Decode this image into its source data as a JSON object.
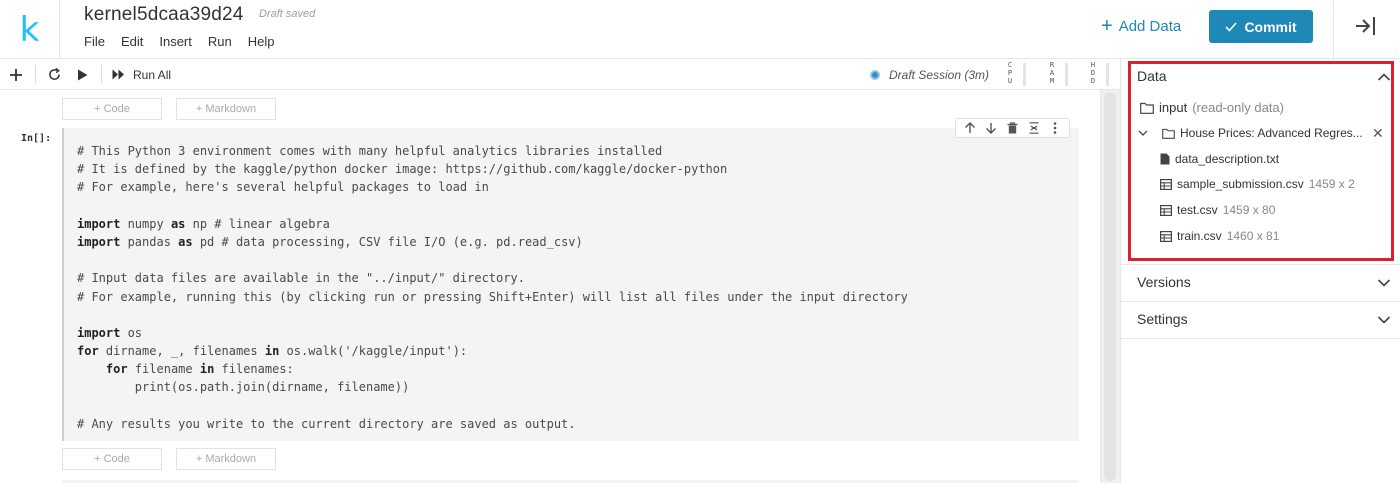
{
  "header": {
    "logo_letter": "k",
    "title": "kernel5dcaa39d24",
    "status": "Draft saved",
    "menu": [
      "File",
      "Edit",
      "Insert",
      "Run",
      "Help"
    ],
    "add_data_label": "Add Data",
    "commit_label": "Commit"
  },
  "toolbar": {
    "run_all_label": "Run All",
    "session_label": "Draft Session (3m)",
    "meters": [
      "CPU",
      "RAM",
      "HDD"
    ]
  },
  "notebook": {
    "add_code_label": "+ Code",
    "add_markdown_label": "+ Markdown",
    "prompt": "In[]:",
    "code_lines": [
      "# This Python 3 environment comes with many helpful analytics libraries installed",
      "# It is defined by the kaggle/python docker image: https://github.com/kaggle/docker-python",
      "# For example, here's several helpful packages to load in",
      "",
      "import numpy as np # linear algebra",
      "import pandas as pd # data processing, CSV file I/O (e.g. pd.read_csv)",
      "",
      "# Input data files are available in the \"../input/\" directory.",
      "# For example, running this (by clicking run or pressing Shift+Enter) will list all files under the input directory",
      "",
      "import os",
      "for dirname, _, filenames in os.walk('/kaggle/input'):",
      "    for filename in filenames:",
      "        print(os.path.join(dirname, filename))",
      "",
      "# Any results you write to the current directory are saved as output."
    ]
  },
  "side_panel": {
    "data_title": "Data",
    "input_label": "input",
    "input_note": "(read-only data)",
    "dataset_name": "House Prices: Advanced Regres...",
    "files": [
      {
        "name": "data_description.txt",
        "dims": "",
        "icon": "file-icon"
      },
      {
        "name": "sample_submission.csv",
        "dims": "1459 x 2",
        "icon": "table-icon"
      },
      {
        "name": "test.csv",
        "dims": "1459 x 80",
        "icon": "table-icon"
      },
      {
        "name": "train.csv",
        "dims": "1460 x 81",
        "icon": "table-icon"
      }
    ],
    "versions_title": "Versions",
    "settings_title": "Settings",
    "highlight_color": "#d7232f"
  },
  "colors": {
    "accent": "#1e88b6",
    "logo": "#20beff"
  }
}
